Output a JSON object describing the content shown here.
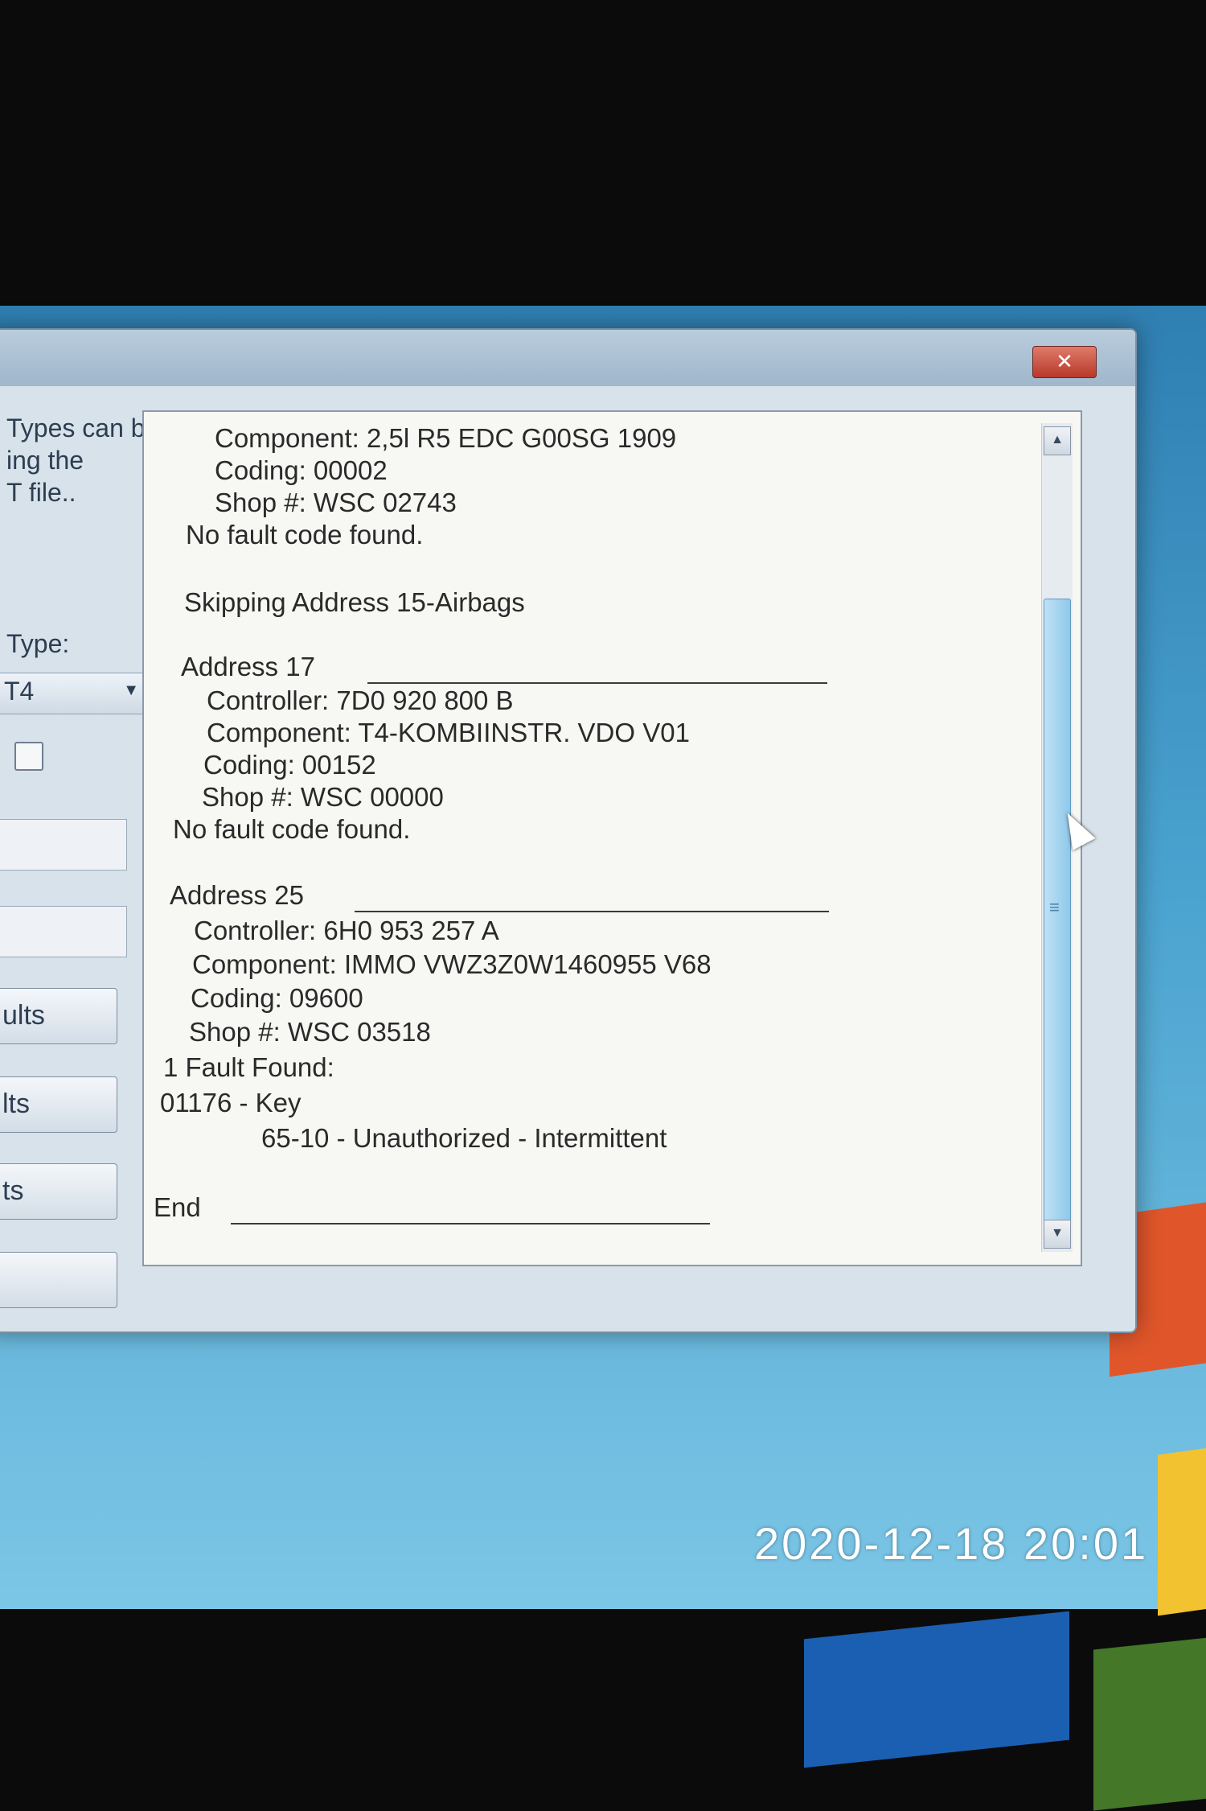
{
  "window": {
    "title": "",
    "close_label": "✕"
  },
  "left_panel": {
    "description_lines": [
      "Types can be",
      "ing the",
      "T file.."
    ],
    "type_label": "Type:",
    "type_value": "T4",
    "button_labels": [
      "ults",
      "lts",
      "ts",
      ""
    ]
  },
  "log": {
    "lines": [
      "Component:  2,5l R5 EDC  G00SG  1909",
      "Coding: 00002",
      "Shop #: WSC 02743",
      "No fault code found.",
      "Skipping Address 15-Airbags",
      "Address 17",
      "Controller: 7D0 920 800 B",
      "Component: T4-KOMBIINSTR. VDO V01",
      "Coding: 00152",
      "Shop #: WSC 00000",
      "No fault code found.",
      "Address 25",
      "Controller: 6H0 953 257 A",
      "Component: IMMO VWZ3Z0W1460955 V68",
      "Coding: 09600",
      "Shop #: WSC 03518",
      "1 Fault Found:",
      "01176 - Key",
      "65-10 - Unauthorized - Intermittent",
      "End"
    ]
  },
  "scrollbar": {
    "up_arrow": "▲",
    "down_arrow": "▼",
    "grip": "≡"
  },
  "photo": {
    "timestamp": "2020-12-18 20:01"
  },
  "icons": [
    "close-icon",
    "dropdown-arrow-icon",
    "scroll-up-icon",
    "scroll-down-icon",
    "mouse-cursor-icon"
  ]
}
